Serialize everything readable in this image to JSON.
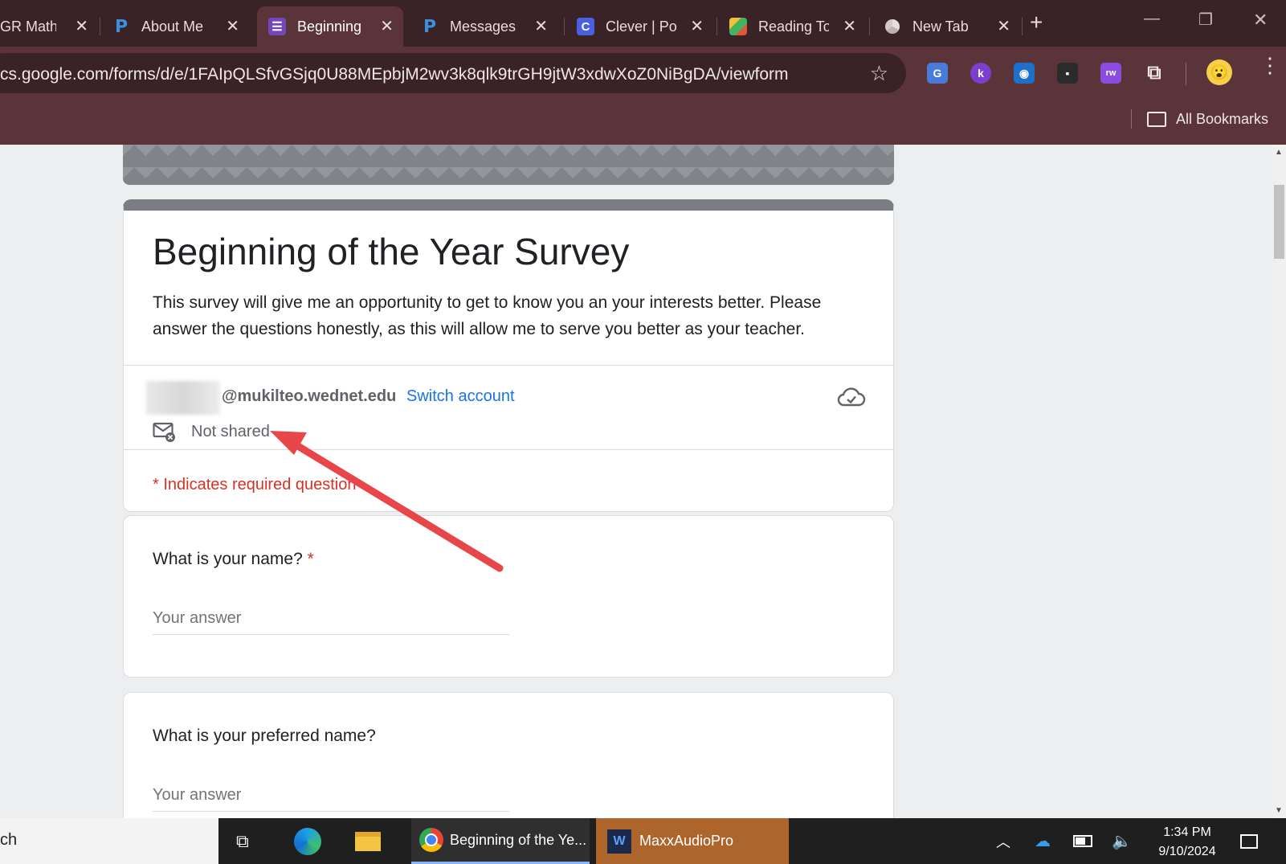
{
  "browser": {
    "tabs": [
      {
        "title": "GR Math",
        "icon": "generic-tab-icon"
      },
      {
        "title": "About Me",
        "icon": "p-logo-icon"
      },
      {
        "title": "Beginning",
        "icon": "forms-icon",
        "active": true
      },
      {
        "title": "Messages",
        "icon": "p-logo-icon"
      },
      {
        "title": "Clever | Po",
        "icon": "clever-icon"
      },
      {
        "title": "Reading To",
        "icon": "cube-icon"
      },
      {
        "title": "New Tab",
        "icon": "chrome-icon"
      }
    ],
    "url": "cs.google.com/forms/d/e/1FAIpQLSfvGSjq0U88MEpbjM2wv3k8qlk9trGH9jtW3xdwXoZ0NiBgDA/viewform",
    "bookmarks_label": "All Bookmarks",
    "extensions": [
      {
        "name": "translate-extension-icon",
        "label": "G",
        "color": "#4a7bd8"
      },
      {
        "name": "kami-extension-icon",
        "label": "k",
        "color": "#7b3fd0"
      },
      {
        "name": "blue-extension-icon",
        "label": "◉",
        "color": "#1d6fc9"
      },
      {
        "name": "cc-extension-icon",
        "label": "▪",
        "color": "#2b2b2b"
      },
      {
        "name": "rw-extension-icon",
        "label": "rw",
        "color": "#8a4be0"
      },
      {
        "name": "puzzle-extension-icon",
        "label": "⧉",
        "color": "#5a3438"
      }
    ]
  },
  "form": {
    "title": "Beginning of the Year Survey",
    "description": "This survey will give me an opportunity to get to know you an your interests better. Please answer the questions honestly, as this will allow me to serve you better as your teacher.",
    "account_email": "@mukilteo.wednet.edu",
    "switch_account": "Switch account",
    "not_shared": "Not shared",
    "required_note": "* Indicates required question",
    "questions": [
      {
        "title": "What is your name?",
        "required_mark": "*",
        "placeholder": "Your answer"
      },
      {
        "title": "What is your preferred name?",
        "required_mark": "",
        "placeholder": "Your answer"
      }
    ]
  },
  "taskbar": {
    "search_text": "ch",
    "chrome_window": "Beginning of the Ye...",
    "maxx_window": "MaxxAudioPro",
    "time": "1:34 PM",
    "date": "9/10/2024"
  },
  "colors": {
    "accent": "#7a7d83",
    "link": "#1a73e8",
    "required": "#d93025",
    "annotation_arrow": "#e8474a"
  }
}
